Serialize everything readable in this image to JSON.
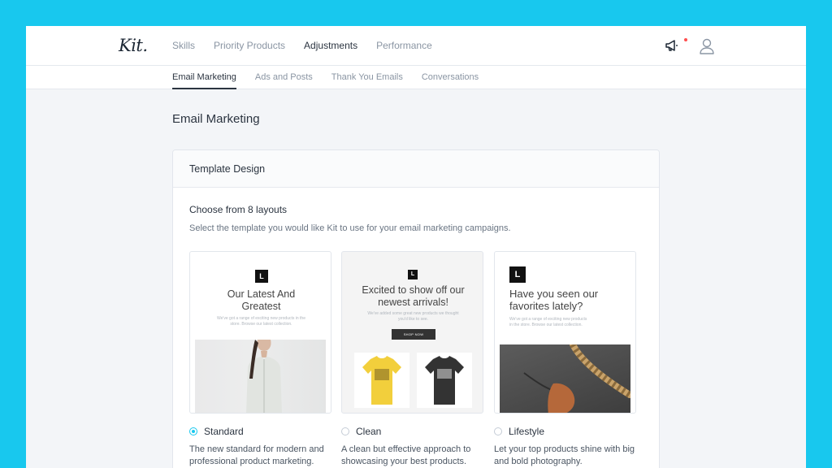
{
  "brand": {
    "logo_text": "Kit."
  },
  "nav": {
    "items": [
      {
        "label": "Skills",
        "active": false
      },
      {
        "label": "Priority Products",
        "active": false
      },
      {
        "label": "Adjustments",
        "active": true
      },
      {
        "label": "Performance",
        "active": false
      }
    ]
  },
  "header_icons": {
    "announce": "megaphone-icon",
    "profile": "user-icon",
    "notification_color": "#ff4e4e"
  },
  "subnav": {
    "items": [
      {
        "label": "Email Marketing",
        "active": true
      },
      {
        "label": "Ads and Posts",
        "active": false
      },
      {
        "label": "Thank You Emails",
        "active": false
      },
      {
        "label": "Conversations",
        "active": false
      }
    ]
  },
  "page": {
    "title": "Email Marketing"
  },
  "card": {
    "header": "Template Design",
    "choose_title": "Choose from 8 layouts",
    "choose_desc": "Select the template you would like Kit to use for your email marketing campaigns."
  },
  "templates": [
    {
      "name": "Standard",
      "selected": true,
      "description": "The new standard for modern and professional product marketing.",
      "thumb_logo": "L",
      "thumb_heading": "Our Latest And Greatest",
      "thumb_body": "We've got a range of exciting new products in the store. Browse our latest collection."
    },
    {
      "name": "Clean",
      "selected": false,
      "description": "A clean but effective approach to showcasing your best products.",
      "thumb_logo": "L",
      "thumb_heading": "Excited to show off our newest arrivals!",
      "thumb_body": "We've added some great new products we thought you'd like to see.",
      "thumb_button": "SHOP NOW"
    },
    {
      "name": "Lifestyle",
      "selected": false,
      "description": "Let your top products shine with big and bold photography.",
      "thumb_logo": "L",
      "thumb_heading": "Have you seen our favorites lately?",
      "thumb_body": "We've got a range of exciting new products in the store. Browse our latest collection."
    }
  ],
  "colors": {
    "accent": "#18c8ee",
    "text": "#2b3440",
    "muted": "#8a95a3"
  }
}
